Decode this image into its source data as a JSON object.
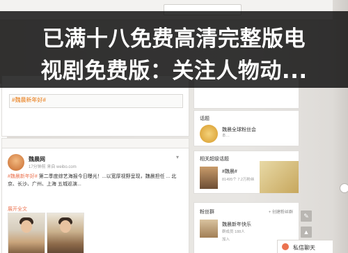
{
  "overlay": {
    "line1": "已满十八免费高清完整版电",
    "line2": "视剧免费版：关注人物动..."
  },
  "composer": {
    "topic": "#魏晨新年好#",
    "lead": ""
  },
  "post": {
    "author": "魏晨网",
    "meta": "17分钟前 来自 weibo.com",
    "body_topic": "#魏晨新年好#",
    "body_text": "第二季度综艺海报今日曝光！...以宽厚视野呈现，魏晨担任 ... 北京、长沙、广州、上海 五城巡演...",
    "expand": "展开全文"
  },
  "right": {
    "topic_header": "话题",
    "topic_name": "魏晨全球粉丝会",
    "topic_sub": "本…",
    "super_header": "相关超级话题",
    "super_name": "#魏晨#",
    "super_sub": "81495个 7.2万粉丝",
    "fans_header": "粉丝群",
    "fans_create": "+ 创建粉丝群",
    "fans_name": "魏晨新年快乐",
    "fans_sub": "群成员 188人",
    "fans_join": "加入"
  },
  "chat": {
    "label": "私信聊天"
  },
  "icons": {
    "edit": "✎",
    "up": "▲"
  }
}
